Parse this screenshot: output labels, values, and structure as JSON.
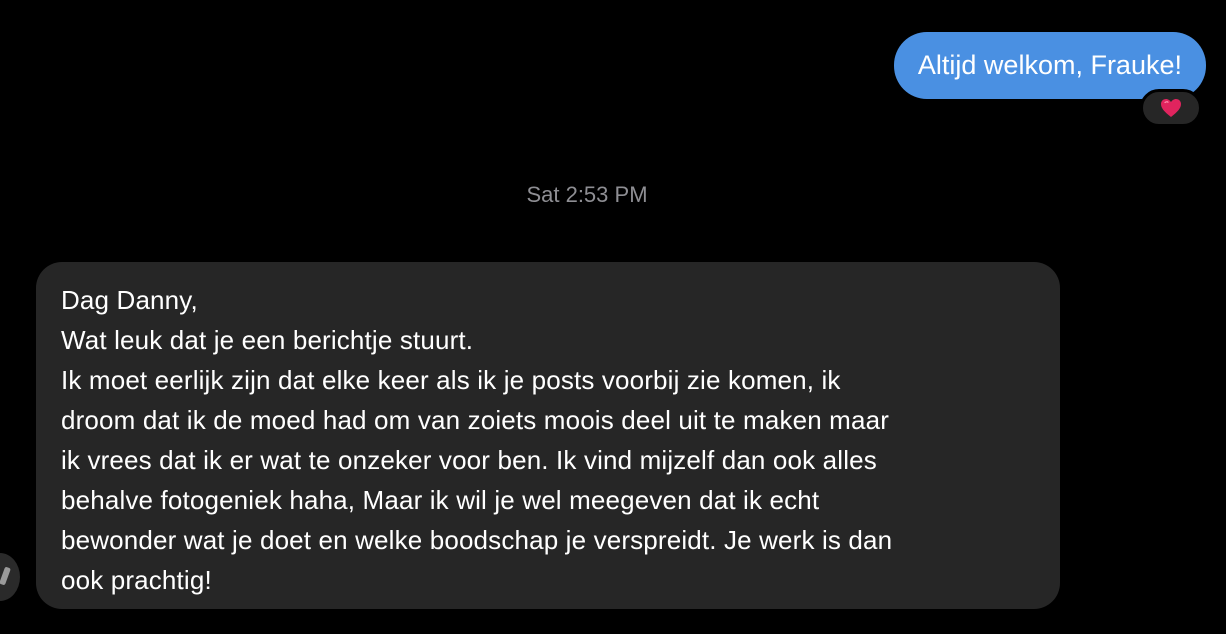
{
  "thread": {
    "outgoing_message": "Altijd welkom, Frauke!",
    "reaction": {
      "icon": "heart-icon",
      "color": "#e0245e"
    },
    "timestamp": "Sat 2:53 PM",
    "incoming_message": {
      "lines": [
        "Dag Danny,",
        "Wat leuk dat je een berichtje stuurt.",
        "Ik moet eerlijk zijn dat elke keer als ik je posts voorbij zie komen, ik",
        "droom dat ik de moed had om van zoiets moois deel uit te maken maar",
        "ik vrees dat ik er wat te onzeker voor ben. Ik vind mijzelf dan ook alles",
        "behalve fotogeniek haha, Maar ik wil je wel meegeven dat ik echt",
        "bewonder wat je doet en welke boodschap je verspreidt. Je werk is dan",
        "ook prachtig!"
      ]
    }
  },
  "colors": {
    "background": "#000000",
    "outgoing_bubble": "#4a90e2",
    "incoming_bubble": "#262626",
    "timestamp_text": "#8e8e93"
  }
}
